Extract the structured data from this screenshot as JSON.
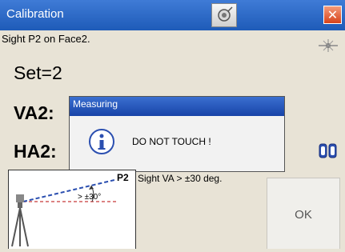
{
  "window": {
    "title": "Calibration"
  },
  "screen": {
    "instruction": "Sight P2 on Face2.",
    "set_label": "Set=2",
    "va_label": "VA2:",
    "ha_label": "HA2:"
  },
  "dialog": {
    "title": "Measuring",
    "message": "DO NOT TOUCH !"
  },
  "diagram": {
    "point_label": "P2",
    "angle_label": "> ±30°"
  },
  "hint": {
    "text": "Sight VA > ±30 deg."
  },
  "buttons": {
    "ok": "OK"
  },
  "colors": {
    "titlebar": "#1e5bb8",
    "close": "#d7431a",
    "dialog_title": "#1844a8",
    "background": "#e8e3d6"
  },
  "icons": [
    "target-prism-icon",
    "close-icon",
    "sun-icon",
    "info-icon",
    "battery-icon",
    "total-station-icon"
  ]
}
